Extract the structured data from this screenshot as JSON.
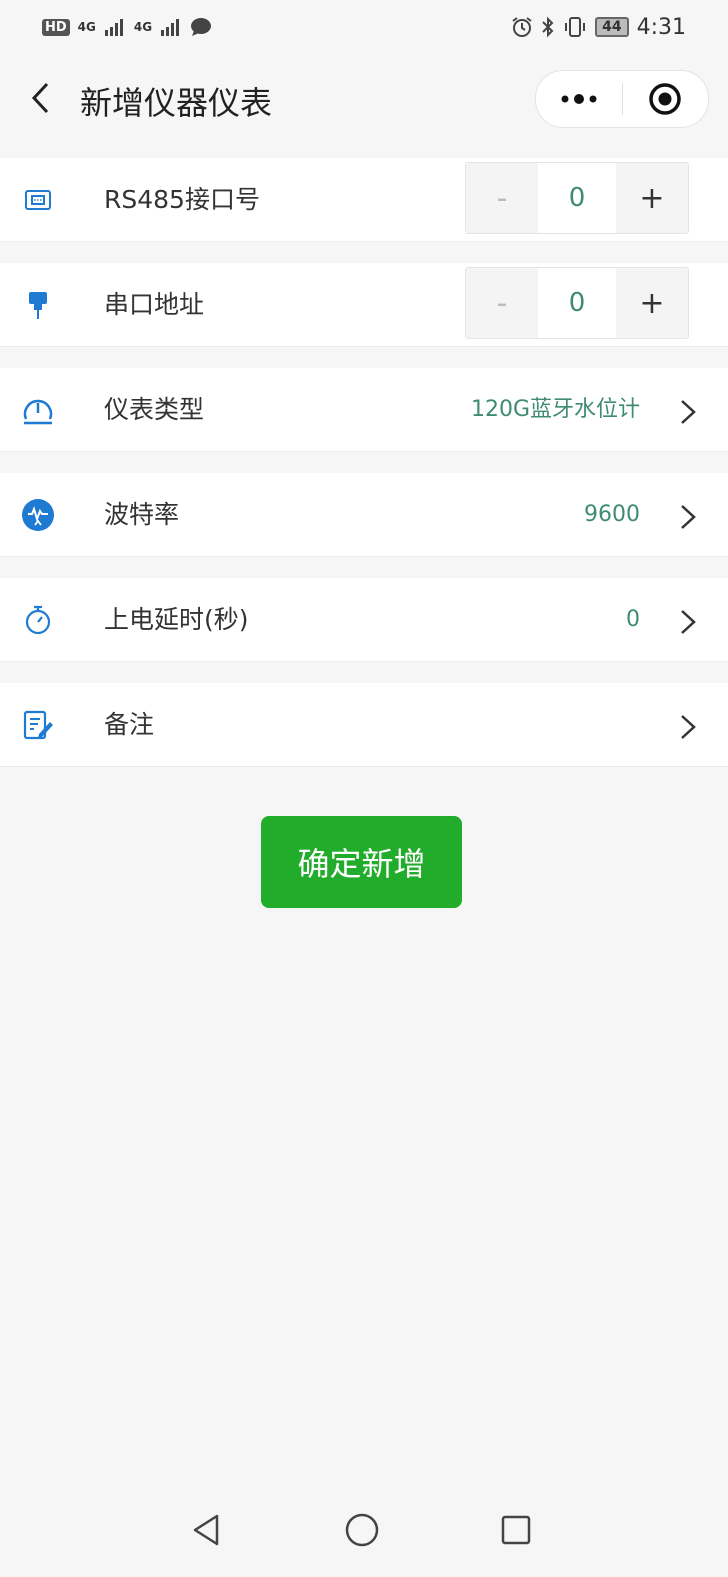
{
  "status_bar": {
    "hd_badge": "HD",
    "net1": "4G",
    "net2": "4G",
    "battery": "44",
    "time": "4:31"
  },
  "nav": {
    "title": "新增仪器仪表",
    "back_icon": "chevron-left-icon",
    "more_icon": "more-dots-icon",
    "close_icon": "target-circle-icon"
  },
  "form": {
    "rs485": {
      "label": "RS485接口号",
      "minus": "-",
      "value": "0",
      "plus": "+",
      "icon": "ethernet-port-icon"
    },
    "serial_address": {
      "label": "串口地址",
      "minus": "-",
      "value": "0",
      "plus": "+",
      "icon": "serial-plug-icon"
    },
    "meter_type": {
      "label": "仪表类型",
      "value": "120G蓝牙水位计",
      "icon": "gauge-icon"
    },
    "baud_rate": {
      "label": "波特率",
      "value": "9600",
      "icon": "signal-wave-icon"
    },
    "power_delay": {
      "label": "上电延时(秒)",
      "value": "0",
      "icon": "stopwatch-icon"
    },
    "remark": {
      "label": "备注",
      "value": "",
      "icon": "edit-note-icon"
    }
  },
  "submit_label": "确定新增",
  "colors": {
    "accent_green": "#21ad2b",
    "value_green": "#3f8c6f",
    "icon_blue": "#1f7ad1"
  }
}
